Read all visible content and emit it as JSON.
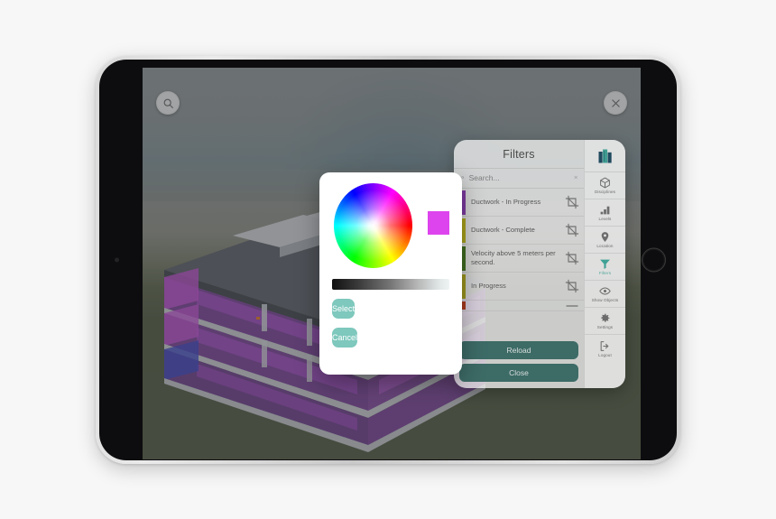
{
  "device": {
    "type": "tablet",
    "orientation": "landscape"
  },
  "viewport": {
    "search_button_icon": "search-icon",
    "close_button_icon": "close-icon",
    "sky_color": "#8b9498",
    "ground_color": "#4e5942",
    "model_description": "3D BIM building model with purple ductwork",
    "model_colors": {
      "roof": "#5a5f69",
      "slab": "#c9cdd4",
      "duct_purple": "#8b3fa8",
      "duct_magenta": "#a94fc9",
      "duct_blue": "#2a3fbb",
      "wall": "#b9bec6"
    }
  },
  "filters_panel": {
    "title": "Filters",
    "search": {
      "placeholder": "Search...",
      "value": "",
      "icon": "search-icon",
      "clear_icon": "close-icon"
    },
    "rows": [
      {
        "label": "Ductwork - In Progress",
        "color": "#7b3a9e",
        "icon": "crop-isolate-icon"
      },
      {
        "label": "Ductwork - Complete",
        "color": "#a8a11c",
        "icon": "crop-isolate-icon"
      },
      {
        "label": "Velocity above 5 meters per second.",
        "color": "#3f6a20",
        "icon": "crop-isolate-icon"
      },
      {
        "label": "In Progress",
        "color": "#9a9420",
        "icon": "crop-isolate-icon"
      },
      {
        "label": "",
        "color": "#a83a1e",
        "icon": "dash-icon"
      }
    ],
    "reload_label": "Reload",
    "close_label": "Close",
    "button_color": "#3d6b66"
  },
  "rail": {
    "logo_icon": "building-logo-icon",
    "active_item": "Filters",
    "active_color": "#56a79d",
    "items": [
      {
        "label": "Disciplines",
        "icon": "cube-icon"
      },
      {
        "label": "Levels",
        "icon": "bar-chart-icon"
      },
      {
        "label": "Location",
        "icon": "map-pin-icon"
      },
      {
        "label": "Filters",
        "icon": "funnel-icon"
      },
      {
        "label": "Show Objects",
        "icon": "eye-icon"
      },
      {
        "label": "Settings",
        "icon": "gear-icon"
      },
      {
        "label": "Logout",
        "icon": "logout-icon"
      }
    ]
  },
  "color_dialog": {
    "wheel_icon": "color-wheel",
    "selected_color": "#dd44ee",
    "slider_icon": "brightness-slider",
    "select_label": "Select",
    "cancel_label": "Cancel",
    "button_color": "#7ec8bd"
  }
}
